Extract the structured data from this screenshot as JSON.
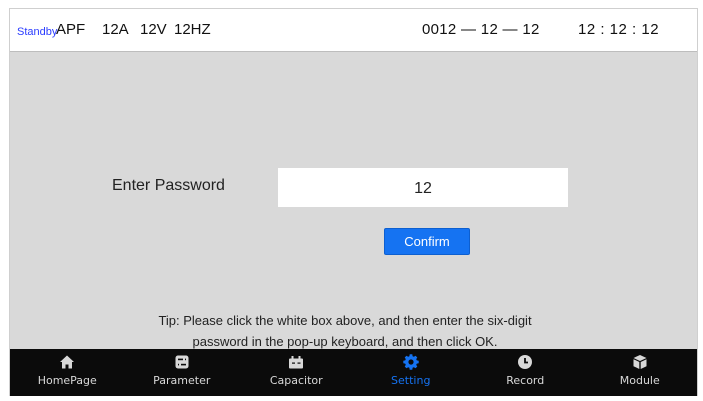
{
  "status_bar": {
    "status": "Standby",
    "mode": "APF",
    "current": "12A",
    "voltage": "12V",
    "frequency": "12HZ",
    "date": "0012 — 12 — 12",
    "time": "12 : 12 : 12"
  },
  "password_form": {
    "label": "Enter Password",
    "value": "12",
    "confirm_label": "Confirm",
    "tip_line1": "Tip: Please click the white box above, and then enter the six-digit",
    "tip_line2": "password in the pop-up keyboard, and then click OK."
  },
  "nav": {
    "active": "Setting",
    "active_color": "#1573f2",
    "items": [
      {
        "label": "HomePage",
        "icon": "home-icon"
      },
      {
        "label": "Parameter",
        "icon": "sliders-icon"
      },
      {
        "label": "Capacitor",
        "icon": "capacitor-icon"
      },
      {
        "label": "Setting",
        "icon": "gear-icon"
      },
      {
        "label": "Record",
        "icon": "clock-icon"
      },
      {
        "label": "Module",
        "icon": "cube-icon"
      }
    ]
  }
}
